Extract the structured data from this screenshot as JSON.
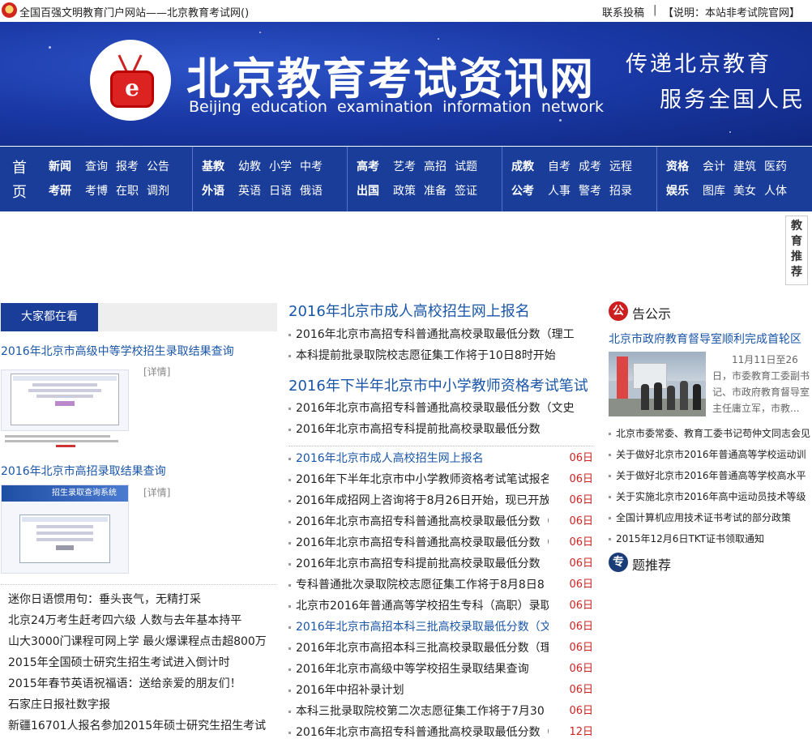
{
  "topbar": {
    "slogan": "全国百强文明教育门户网站——北京教育考试网()",
    "contact": "联系投稿",
    "separator": "|",
    "notice": "【说明：本站非考试院官网】"
  },
  "banner": {
    "logo_letter": "e",
    "title_cn": "北京教育考试资讯网",
    "title_en": "Beijing education examination information network",
    "motto_line1": "传递北京教育",
    "motto_line2": "服务全国人民"
  },
  "nav": {
    "home_line1": "首",
    "home_line2": "页",
    "groups": [
      {
        "row1": [
          "新闻",
          "查询",
          "报考",
          "公告"
        ],
        "row2": [
          "考研",
          "考博",
          "在职",
          "调剂"
        ]
      },
      {
        "row1": [
          "基教",
          "幼教",
          "小学",
          "中考"
        ],
        "row2": [
          "外语",
          "英语",
          "日语",
          "俄语"
        ]
      },
      {
        "row1": [
          "高考",
          "艺考",
          "高招",
          "试题"
        ],
        "row2": [
          "出国",
          "政策",
          "准备",
          "签证"
        ]
      },
      {
        "row1": [
          "成教",
          "自考",
          "成考",
          "远程"
        ],
        "row2": [
          "公考",
          "人事",
          "警考",
          "招录"
        ]
      },
      {
        "row1": [
          "资格",
          "会计",
          "建筑",
          "医药"
        ],
        "row2": [
          "娱乐",
          "图库",
          "美女",
          "人体"
        ]
      }
    ]
  },
  "float_recommend": "教育推荐",
  "left": {
    "tab_active": "大家都在看",
    "feature1": {
      "title": "2016年北京市高级中等学校招生录取结果查询",
      "detail": "[详情]"
    },
    "feature2": {
      "title": "2016年北京市高招录取结果查询",
      "detail": "[详情]"
    },
    "thumb2_banner": "招生录取查询系统",
    "list": [
      "迷你日语惯用句：垂头丧气，无精打采",
      "北京24万考生赶考四六级 人数与去年基本持平",
      "山大3000门课程可网上学 最火爆课程点击超800万",
      "2015年全国硕士研究生招生考试进入倒计时",
      "2015年春节英语祝福语：送给亲爱的朋友们！",
      "石家庄日报社数字报",
      "新疆16701人报名参加2015年硕士研究生招生考试"
    ]
  },
  "mid": {
    "head1": "2016年北京市成人高校招生网上报名",
    "sub1": [
      "2016年北京市高招专科普通批高校录取最低分数（理工",
      "本科提前批录取院校志愿征集工作将于10日8时开始"
    ],
    "head2": "2016年下半年北京市中小学教师资格考试笔试",
    "sub2": [
      "2016年北京市高招专科普通批高校录取最低分数（文史",
      "2016年北京市高招专科提前批高校录取最低分数"
    ],
    "list": [
      {
        "title": "2016年北京市成人高校招生网上报名",
        "date": "06日",
        "blue": true
      },
      {
        "title": "2016年下半年北京市中小学教师资格考试笔试报名",
        "date": "06日",
        "blue": false
      },
      {
        "title": "2016年成招网上咨询将于8月26日开始，现已开放",
        "date": "06日",
        "blue": false
      },
      {
        "title": "2016年北京市高招专科普通批高校录取最低分数（",
        "date": "06日",
        "blue": false
      },
      {
        "title": "2016年北京市高招专科普通批高校录取最低分数（",
        "date": "06日",
        "blue": false
      },
      {
        "title": "2016年北京市高招专科提前批高校录取最低分数",
        "date": "06日",
        "blue": false
      },
      {
        "title": "专科普通批次录取院校志愿征集工作将于8月8日8",
        "date": "06日",
        "blue": false
      },
      {
        "title": "北京市2016年普通高等学校招生专科（高职）录取",
        "date": "06日",
        "blue": false
      },
      {
        "title": "2016年北京市高招本科三批高校录取最低分数（文",
        "date": "06日",
        "blue": true
      },
      {
        "title": "2016年北京市高招本科三批高校录取最低分数（理",
        "date": "06日",
        "blue": false
      },
      {
        "title": "2016年北京市高级中等学校招生录取结果查询",
        "date": "06日",
        "blue": false
      },
      {
        "title": "2016年中招补录计划",
        "date": "06日",
        "blue": false
      },
      {
        "title": "本科三批录取院校第二次志愿征集工作将于7月30",
        "date": "06日",
        "blue": false
      },
      {
        "title": "2016年北京市高招专科普通批高校录取最低分数（",
        "date": "12日",
        "blue": false
      }
    ]
  },
  "right": {
    "sec1_badge": "公",
    "sec1_title": "告公示",
    "head_link": "北京市政府教育督导室顺利完成首轮区",
    "snippet": "11月11日至26日，市委教育工委副书记、市政府教育督导室主任庸立军，市教...",
    "list": [
      "北京市委常委、教育工委书记苟仲文同志会见",
      "关于做好北京市2016年普通高等学校运动训",
      "关于做好北京市2016年普通高等学校高水平",
      "关于实施北京市2016年高中运动员技术等级",
      "全国计算机应用技术证书考试的部分政策",
      "2015年12月6日TKT证书领取通知"
    ],
    "sec2_badge": "专",
    "sec2_title": "题推荐"
  },
  "colors": {
    "nav_bg": "#1a3d9a",
    "link_blue": "#1a56a8",
    "date_red": "#cc2222",
    "badge_red": "#cc1f1f",
    "badge_navy": "#1a3d7a"
  }
}
